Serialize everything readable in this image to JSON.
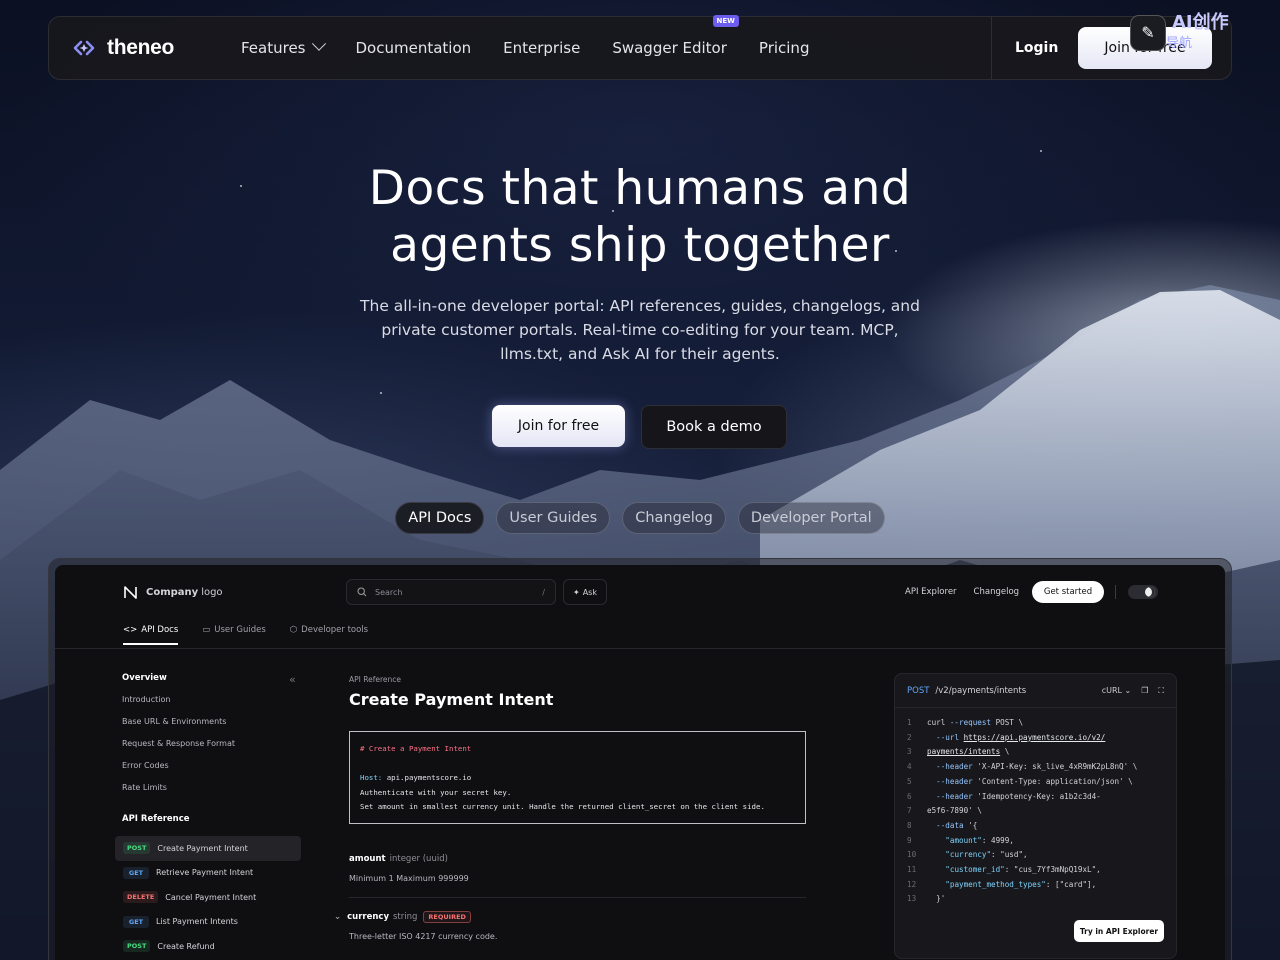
{
  "nav": {
    "logo_text": "theneo",
    "links": [
      {
        "label": "Features"
      },
      {
        "label": "Documentation"
      },
      {
        "label": "Enterprise"
      },
      {
        "label": "Swagger Editor",
        "badge": "NEW"
      },
      {
        "label": "Pricing"
      }
    ],
    "login": "Login",
    "cta": "Join for free",
    "watermark": "AI创作",
    "watermark_sub": "导航"
  },
  "hero": {
    "title_line1": "Docs that humans and",
    "title_line2": "agents ship together",
    "subtitle": "The all-in-one developer portal: API references, guides, changelogs, and private customer portals. Real-time co-editing for your team. MCP, llms.txt, and Ask AI for their agents.",
    "primary_button": "Join for free",
    "secondary_button": "Book a demo",
    "pills": [
      "API Docs",
      "User Guides",
      "Changelog",
      "Developer Portal"
    ]
  },
  "demo": {
    "logo_bold": "Company",
    "logo_light": "logo",
    "search_placeholder": "Search",
    "search_shortcut": "/",
    "ask": "Ask",
    "top_links": [
      "API Explorer",
      "Changelog"
    ],
    "get_started": "Get started",
    "tabs": [
      "API Docs",
      "User Guides",
      "Developer tools"
    ],
    "sidebar": {
      "overview_heading": "Overview",
      "overview_items": [
        "Introduction",
        "Base URL & Environments",
        "Request & Response Format",
        "Error Codes",
        "Rate Limits"
      ],
      "api_heading": "API Reference",
      "endpoints": [
        {
          "method": "POST",
          "label": "Create Payment Intent"
        },
        {
          "method": "GET",
          "label": "Retrieve Payment Intent"
        },
        {
          "method": "DELETE",
          "label": "Cancel Payment Intent"
        },
        {
          "method": "GET",
          "label": "List Payment Intents"
        },
        {
          "method": "POST",
          "label": "Create Refund"
        }
      ]
    },
    "main": {
      "breadcrumb": "API Reference",
      "title": "Create Payment Intent",
      "code_comment": "# Create a Payment Intent",
      "code_host_label": "Host:",
      "code_host": "api.paymentscore.io",
      "code_line2": "Authenticate with your secret key.",
      "code_line3": "Set amount in smallest currency unit. Handle the returned client_secret on the client side.",
      "params": [
        {
          "name": "amount",
          "type": "integer (uuid)",
          "desc": "Minimum 1 Maximum 999999"
        },
        {
          "name": "currency",
          "type": "string",
          "required": "REQUIRED",
          "desc": "Three-letter ISO 4217 currency code."
        }
      ]
    },
    "panel": {
      "method": "POST",
      "path": "/v2/payments/intents",
      "lang": "cURL",
      "try_button": "Try in API Explorer"
    }
  }
}
